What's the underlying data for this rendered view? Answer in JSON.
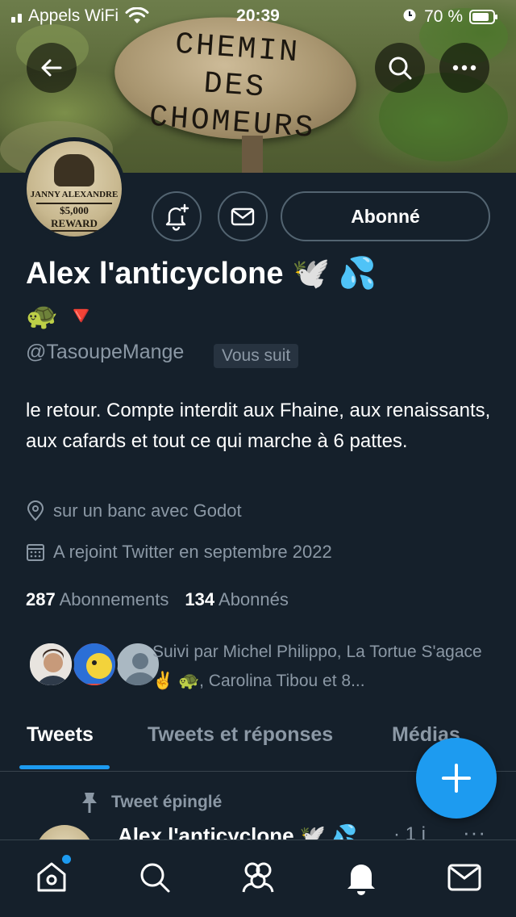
{
  "status_bar": {
    "carrier": "Appels WiFi",
    "time": "20:39",
    "battery": "70 %",
    "battery_level": 0.7
  },
  "banner": {
    "sign_lines": [
      "CHEMIN",
      "DES",
      "CHOMEURS"
    ]
  },
  "avatar": {
    "poster_name": "JANNY ALEXANDRE",
    "poster_reward": "$5,000 REWARD"
  },
  "actions": {
    "follow_label": "Abonné"
  },
  "profile": {
    "name": "Alex l'anticyclone 🕊️ 💦",
    "name_emojis": "🐢 🔻",
    "handle": "@TasoupeMange",
    "follows_you": "Vous suit",
    "bio": "le retour. Compte interdit aux Fhaine, aux renaissants, aux cafards et tout ce qui marche à 6 pattes.",
    "location": "sur un banc avec Godot",
    "joined": "A rejoint Twitter en septembre 2022",
    "following_count": "287",
    "following_label": "Abonnements",
    "followers_count": "134",
    "followers_label": "Abonnés",
    "followed_by": "Suivi par Michel Philippo, La Tortue S'agace ✌️ 🐢, Carolina Tibou et 8..."
  },
  "tabs": [
    "Tweets",
    "Tweets et réponses",
    "Médias"
  ],
  "pinned_tweet": {
    "label": "Tweet épinglé",
    "author": "Alex l'anticyclone 🕊️ 💦",
    "time": "· 1 j",
    "more": "···"
  },
  "colors": {
    "background": "#15202b",
    "accent": "#1d9bf0",
    "secondary_text": "#8b98a5",
    "border": "#536471"
  }
}
